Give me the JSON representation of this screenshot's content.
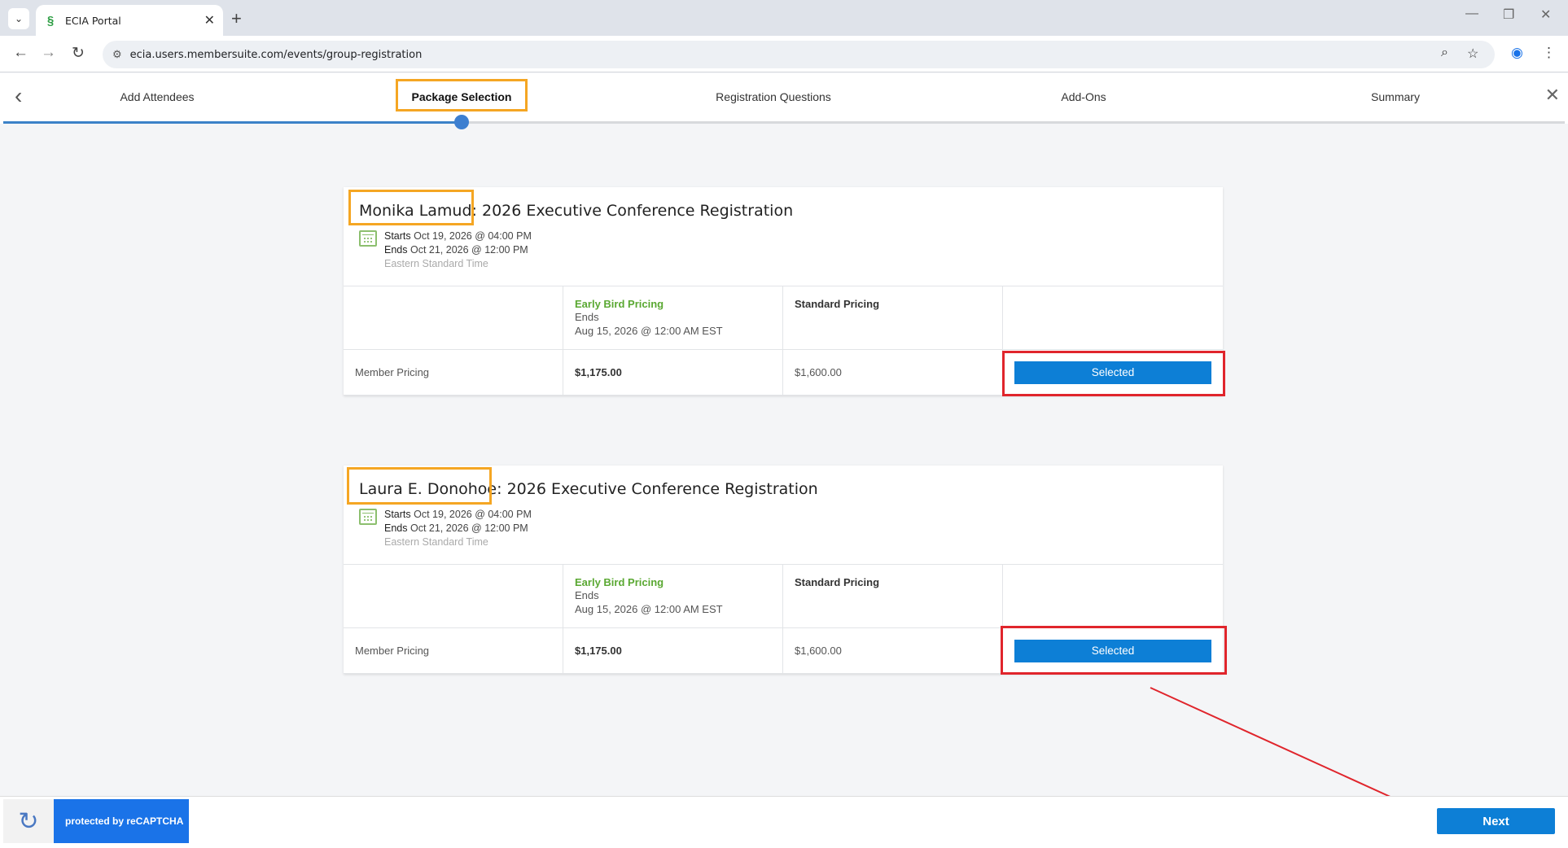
{
  "browser": {
    "tab_title": "ECIA Portal",
    "url": "ecia.users.membersuite.com/events/group-registration"
  },
  "stepper": {
    "steps": [
      "Add Attendees",
      "Package Selection",
      "Registration Questions",
      "Add-Ons",
      "Summary"
    ],
    "active_index": 1
  },
  "registrations": [
    {
      "attendee": "Monika Lamud:",
      "event": "2026 Executive Conference Registration",
      "starts_label": "Starts",
      "starts": "Oct 19, 2026 @ 04:00 PM",
      "ends_label": "Ends",
      "ends": "Oct 21, 2026 @ 12:00 PM",
      "timezone": "Eastern Standard Time",
      "early_header": "Early Bird Pricing",
      "early_ends_label": "Ends",
      "early_ends": "Aug 15, 2026 @ 12:00 AM EST",
      "standard_header": "Standard Pricing",
      "row_label": "Member Pricing",
      "early_price": "$1,175.00",
      "standard_price": "$1,600.00",
      "button": "Selected"
    },
    {
      "attendee": "Laura E. Donohoe:",
      "event": "2026 Executive Conference Registration",
      "starts_label": "Starts",
      "starts": "Oct 19, 2026 @ 04:00 PM",
      "ends_label": "Ends",
      "ends": "Oct 21, 2026 @ 12:00 PM",
      "timezone": "Eastern Standard Time",
      "early_header": "Early Bird Pricing",
      "early_ends_label": "Ends",
      "early_ends": "Aug 15, 2026 @ 12:00 AM EST",
      "standard_header": "Standard Pricing",
      "row_label": "Member Pricing",
      "early_price": "$1,175.00",
      "standard_price": "$1,600.00",
      "button": "Selected"
    }
  ],
  "footer": {
    "recaptcha_text": "protected by reCAPTCHA",
    "next_label": "Next"
  },
  "colors": {
    "accent_blue": "#0d7fd6",
    "early_green": "#5aa832",
    "annotation_orange": "#f5a623",
    "annotation_red": "#e0252c"
  }
}
